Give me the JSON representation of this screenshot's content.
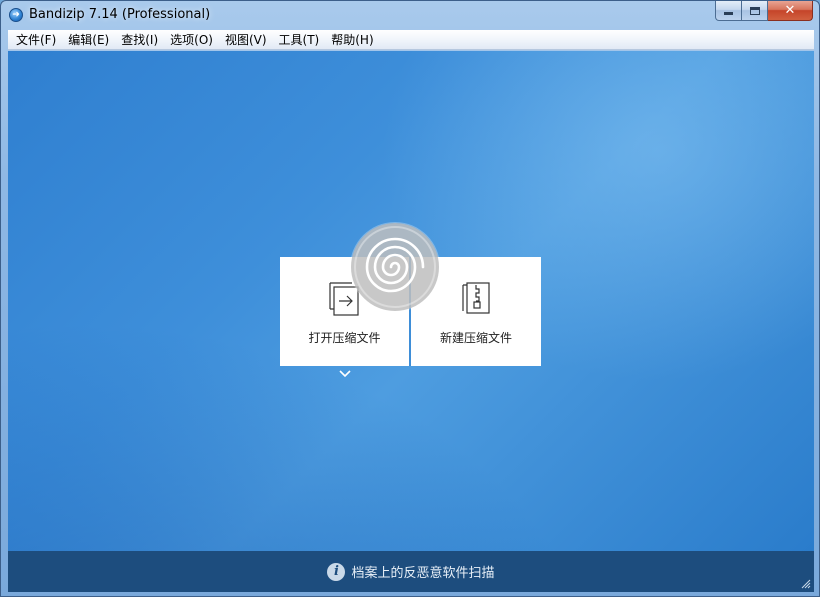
{
  "window": {
    "title": "Bandizip 7.14 (Professional)",
    "app_icon": "bandizip-icon",
    "controls": [
      "minimize-icon",
      "maximize-icon",
      "close-icon"
    ]
  },
  "menu": [
    {
      "label": "文件(F)"
    },
    {
      "label": "编辑(E)"
    },
    {
      "label": "查找(I)"
    },
    {
      "label": "选项(O)"
    },
    {
      "label": "视图(V)"
    },
    {
      "label": "工具(T)"
    },
    {
      "label": "帮助(H)"
    }
  ],
  "tiles": {
    "open": {
      "label": "打开压缩文件",
      "icon": "open-archive-icon"
    },
    "new": {
      "label": "新建压缩文件",
      "icon": "new-archive-icon"
    }
  },
  "status": {
    "text": "档案上的反恶意软件扫描",
    "icon": "info-icon",
    "icon_glyph": "i"
  },
  "colors": {
    "client_bg": "#3e8fda",
    "status_bg": "#1d4d7e",
    "tile_bg": "#ffffff"
  }
}
